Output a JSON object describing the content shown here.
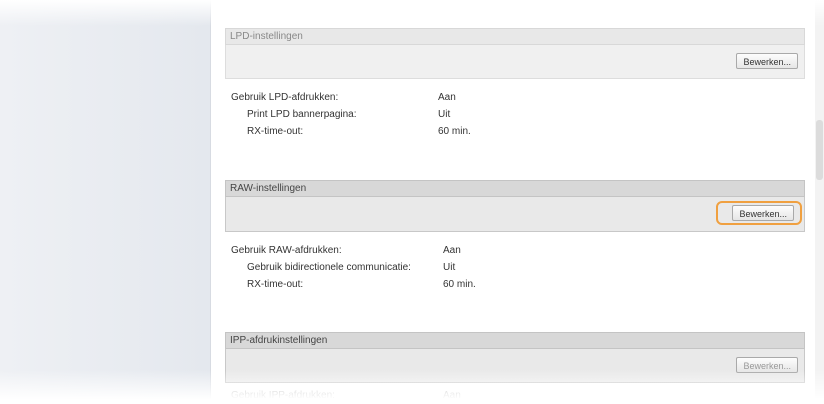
{
  "sections": {
    "lpd": {
      "title": "LPD-instellingen",
      "button": "Bewerken...",
      "rows": [
        {
          "label": "Gebruik LPD-afdrukken:",
          "value": "Aan"
        },
        {
          "label": "Print LPD bannerpagina:",
          "value": "Uit"
        },
        {
          "label": "RX-time-out:",
          "value": "60 min."
        }
      ]
    },
    "raw": {
      "title": "RAW-instellingen",
      "button": "Bewerken...",
      "rows": [
        {
          "label": "Gebruik RAW-afdrukken:",
          "value": "Aan"
        },
        {
          "label": "Gebruik bidirectionele communicatie:",
          "value": "Uit"
        },
        {
          "label": "RX-time-out:",
          "value": "60 min."
        }
      ]
    },
    "ipp": {
      "title": "IPP-afdrukinstellingen",
      "button": "Bewerken...",
      "rows": [
        {
          "label": "Gebruik IPP-afdrukken:",
          "value": "Aan"
        }
      ]
    }
  },
  "colors": {
    "highlight": "#f0a040",
    "header_bg": "#d8d8d8",
    "toolbar_bg": "#e9e9e9"
  }
}
